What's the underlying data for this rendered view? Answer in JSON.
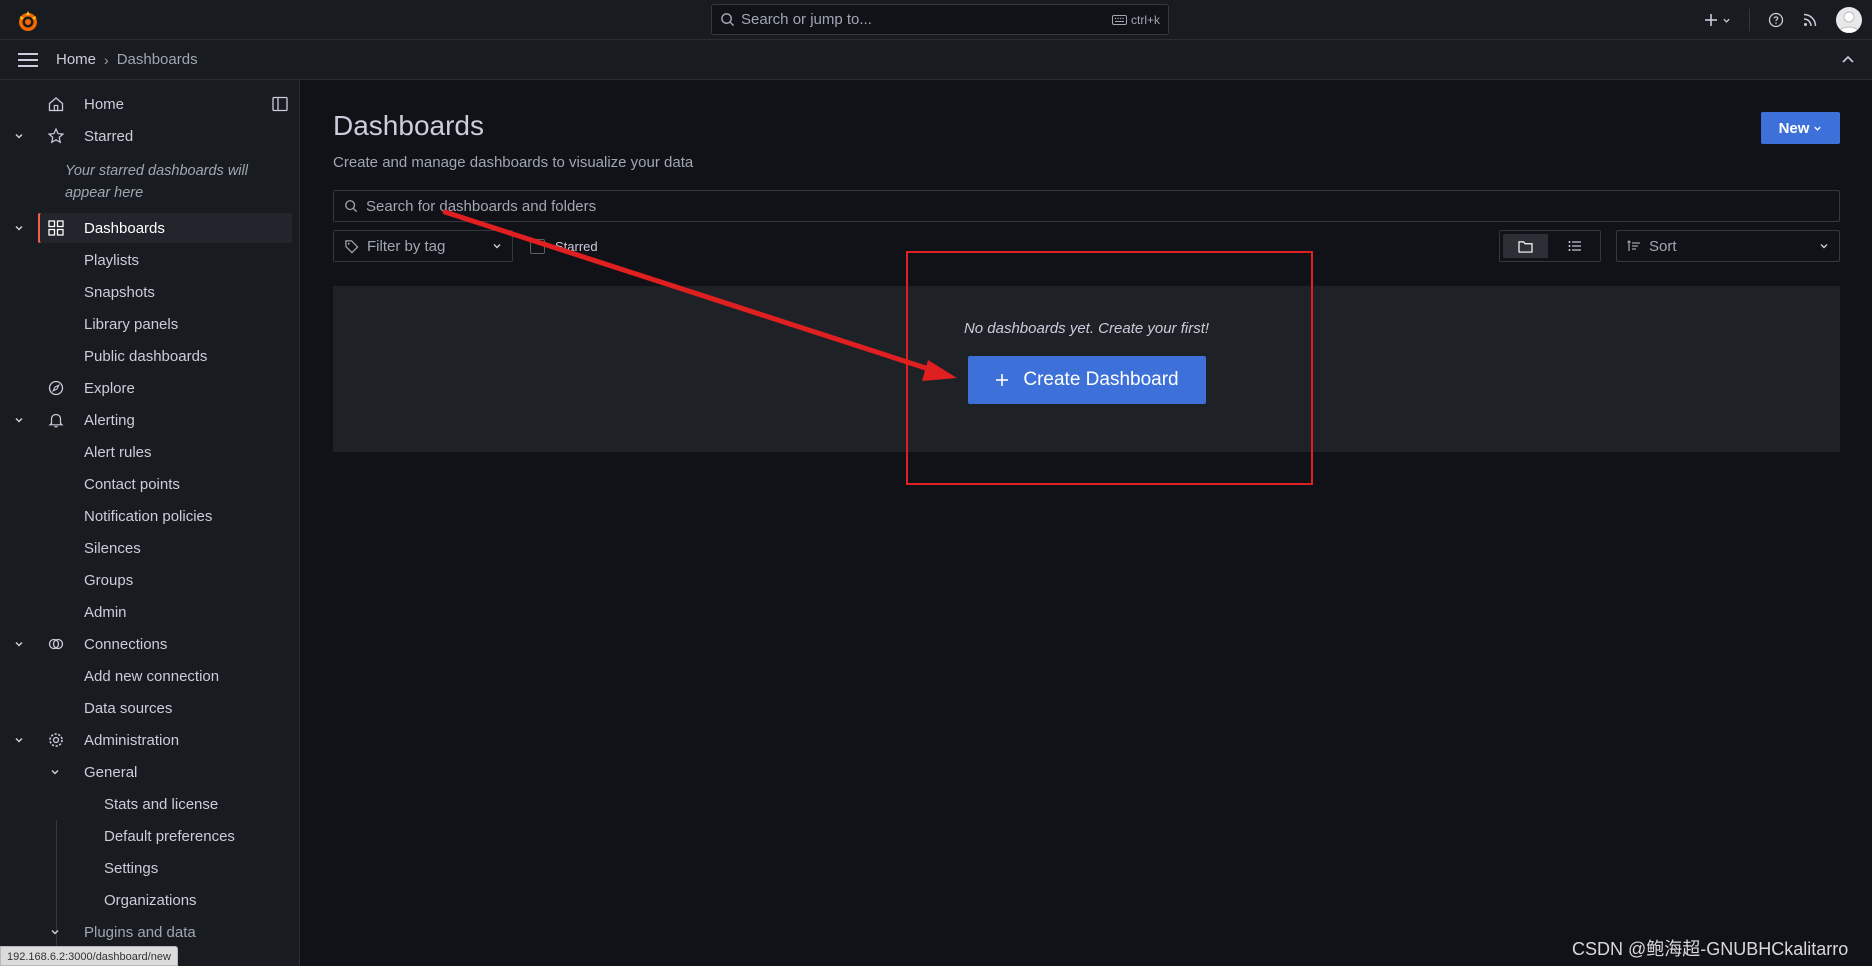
{
  "topbar": {
    "search_placeholder": "Search or jump to...",
    "search_shortcut": "ctrl+k"
  },
  "breadcrumb": {
    "home": "Home",
    "separator": "›",
    "current": "Dashboards"
  },
  "sidebar": {
    "home": "Home",
    "starred": "Starred",
    "starred_empty": "Your starred dashboards will appear here",
    "dashboards": "Dashboards",
    "playlists": "Playlists",
    "snapshots": "Snapshots",
    "library_panels": "Library panels",
    "public_dashboards": "Public dashboards",
    "explore": "Explore",
    "alerting": "Alerting",
    "alert_rules": "Alert rules",
    "contact_points": "Contact points",
    "notification_policies": "Notification policies",
    "silences": "Silences",
    "groups": "Groups",
    "admin": "Admin",
    "connections": "Connections",
    "add_new_connection": "Add new connection",
    "data_sources": "Data sources",
    "administration": "Administration",
    "general": "General",
    "stats_and_license": "Stats and license",
    "default_preferences": "Default preferences",
    "settings": "Settings",
    "organizations": "Organizations",
    "plugins_and_data": "Plugins and data"
  },
  "main": {
    "title": "Dashboards",
    "subtitle": "Create and manage dashboards to visualize your data",
    "new_button": "New",
    "search_placeholder": "Search for dashboards and folders",
    "filter_by_tag": "Filter by tag",
    "starred_label": "Starred",
    "sort_label": "Sort",
    "empty_message": "No dashboards yet. Create your first!",
    "create_button": "Create Dashboard"
  },
  "status_url": "192.168.6.2:3000/dashboard/new",
  "watermark": "CSDN @鲍海超-GNUBHCkalitarro",
  "colors": {
    "primary": "#3d71d9",
    "accent": "#f55f3e",
    "annotation": "#e02020",
    "background": "#111217",
    "panel": "#181b1f"
  }
}
